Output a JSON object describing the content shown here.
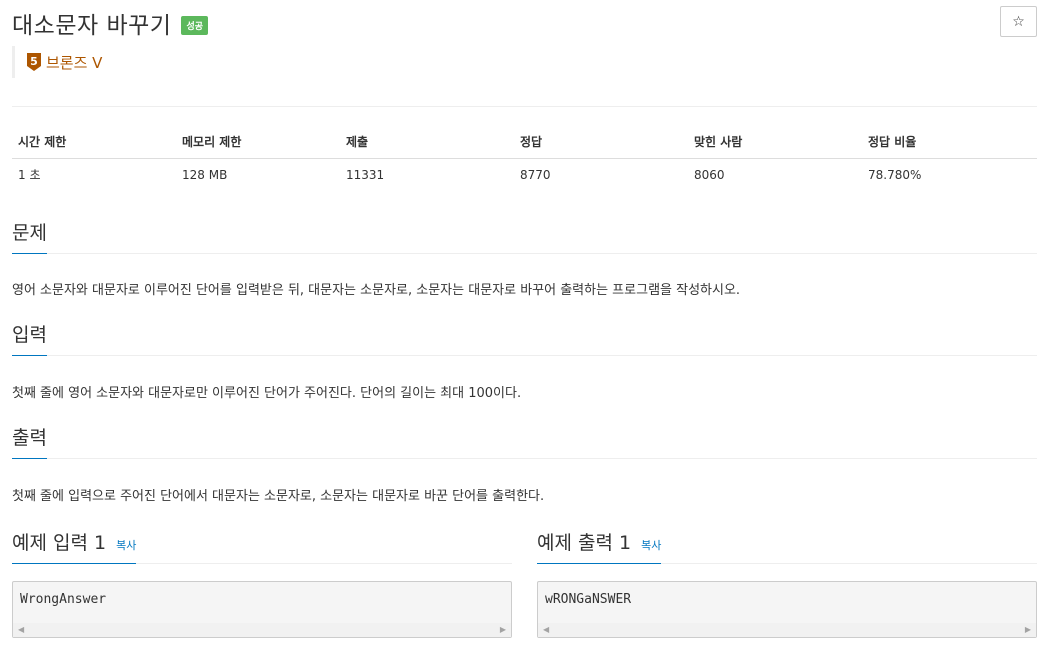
{
  "header": {
    "title": "대소문자 바꾸기",
    "badge": "성공",
    "star_glyph": "☆",
    "tier_number": "5",
    "tier_label": "브론즈 V"
  },
  "stats": {
    "headers": [
      "시간 제한",
      "메모리 제한",
      "제출",
      "정답",
      "맞힌 사람",
      "정답 비율"
    ],
    "values": [
      "1 초",
      "128 MB",
      "11331",
      "8770",
      "8060",
      "78.780%"
    ]
  },
  "sections": {
    "problem": {
      "heading": "문제",
      "text": "영어 소문자와 대문자로 이루어진 단어를 입력받은 뒤, 대문자는 소문자로, 소문자는 대문자로 바꾸어 출력하는 프로그램을 작성하시오."
    },
    "input": {
      "heading": "입력",
      "text": "첫째 줄에 영어 소문자와 대문자로만 이루어진 단어가 주어진다. 단어의 길이는 최대 100이다."
    },
    "output": {
      "heading": "출력",
      "text": "첫째 줄에 입력으로 주어진 단어에서 대문자는 소문자로, 소문자는 대문자로 바꾼 단어를 출력한다."
    }
  },
  "samples": {
    "input": {
      "heading": "예제 입력 1",
      "copy": "복사",
      "content": "WrongAnswer"
    },
    "output": {
      "heading": "예제 출력 1",
      "copy": "복사",
      "content": "wRONGaNSWER"
    }
  },
  "colors": {
    "badge_bg": "#5cb85c",
    "tier": "#ad5600",
    "link": "#0076c0"
  }
}
